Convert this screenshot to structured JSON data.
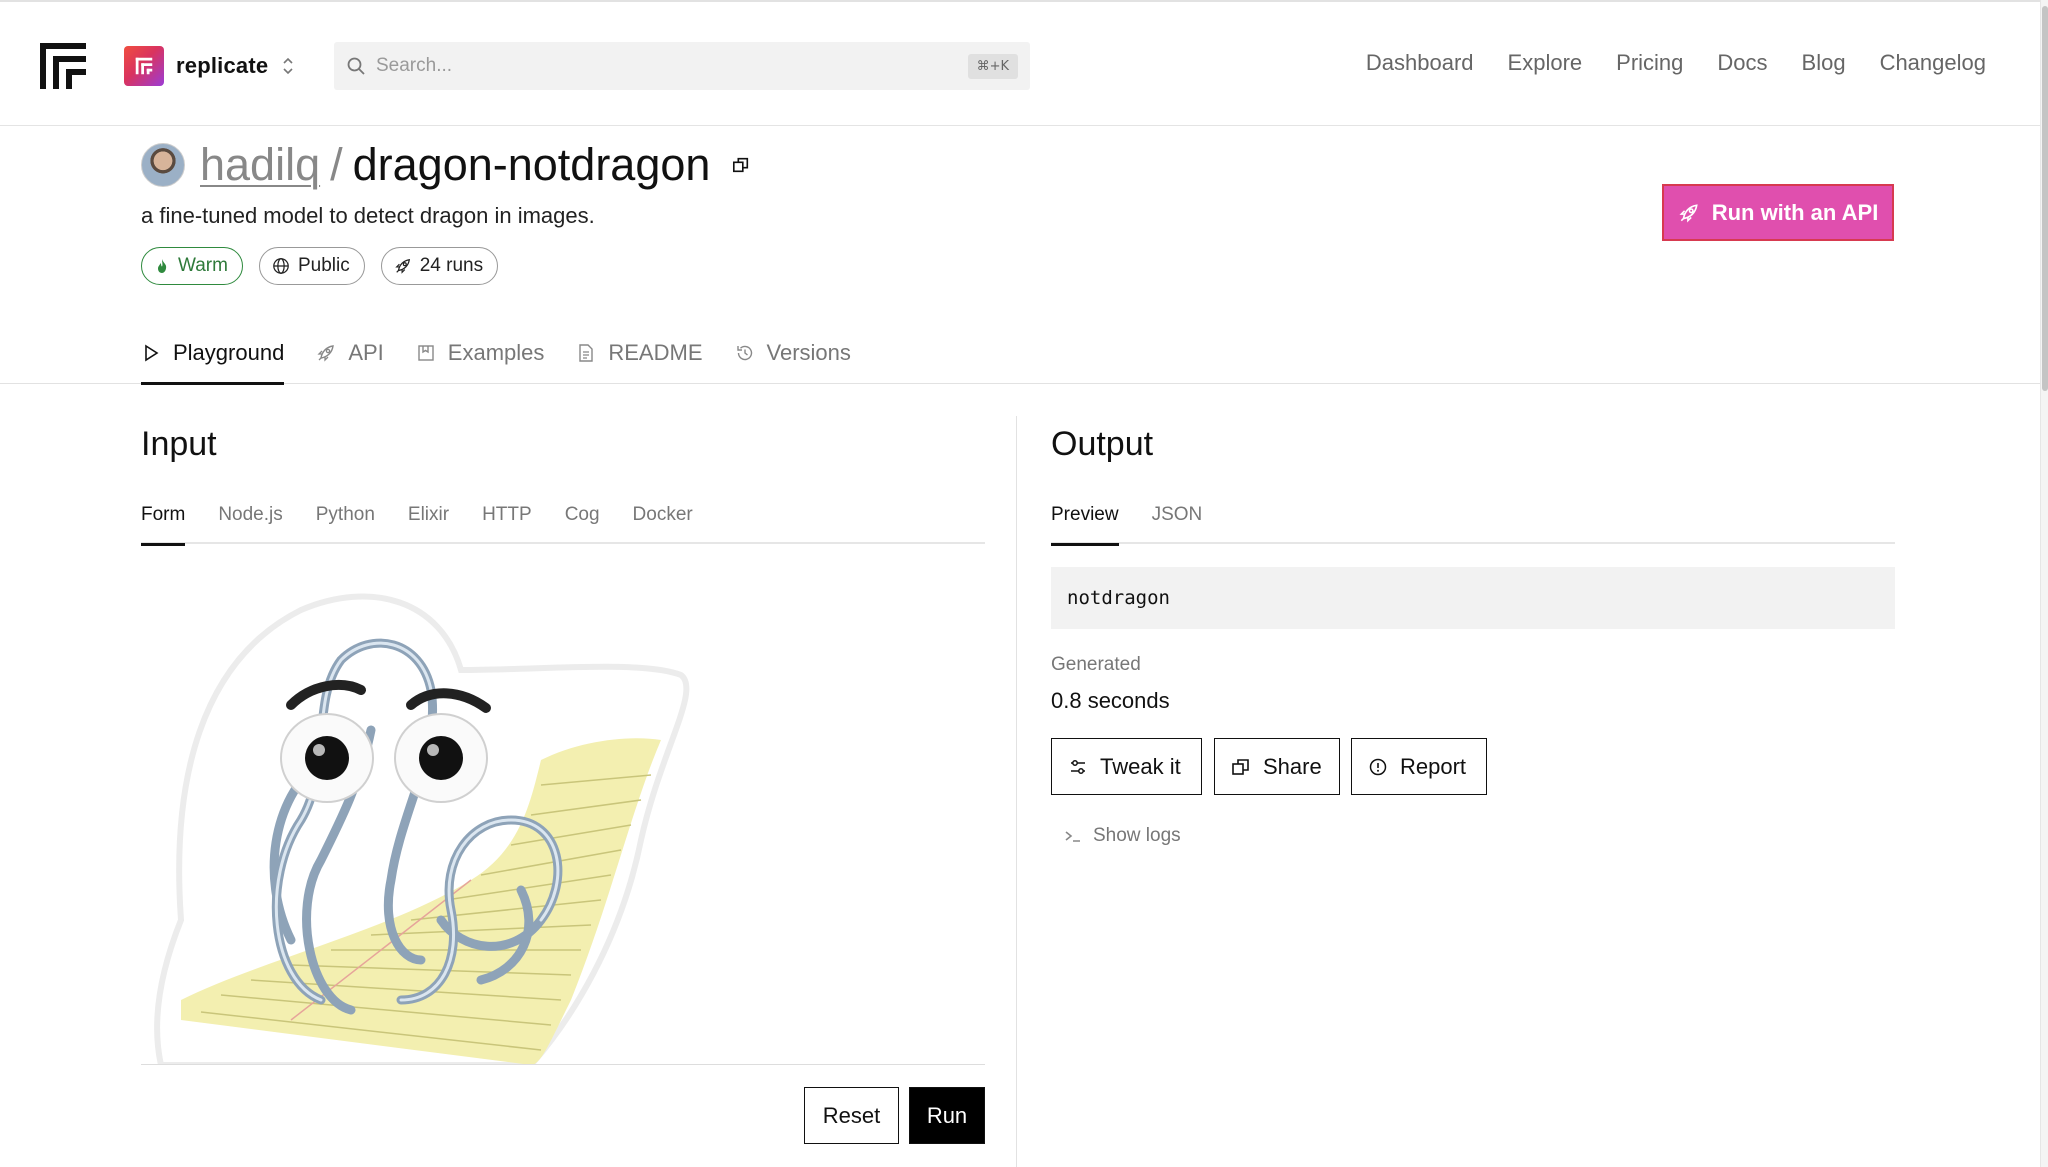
{
  "nav": {
    "org_name": "replicate",
    "search_placeholder": "Search...",
    "search_shortcut": "⌘+K",
    "links": [
      "Dashboard",
      "Explore",
      "Pricing",
      "Docs",
      "Blog",
      "Changelog"
    ]
  },
  "model": {
    "owner": "hadilq",
    "separator": "/",
    "name": "dragon-notdragon",
    "description": "a fine-tuned model to detect dragon in images.",
    "badges": {
      "warm": "Warm",
      "visibility": "Public",
      "runs": "24 runs"
    },
    "api_button": "Run with an API"
  },
  "tabs": [
    "Playground",
    "API",
    "Examples",
    "README",
    "Versions"
  ],
  "input": {
    "title": "Input",
    "subtabs": [
      "Form",
      "Node.js",
      "Python",
      "Elixir",
      "HTTP",
      "Cog",
      "Docker"
    ],
    "reset_label": "Reset",
    "run_label": "Run"
  },
  "output": {
    "title": "Output",
    "subtabs": [
      "Preview",
      "JSON"
    ],
    "result": "notdragon",
    "generated_label": "Generated",
    "generated_value": "0.8 seconds",
    "tweak_label": "Tweak it",
    "share_label": "Share",
    "report_label": "Report",
    "show_logs_label": "Show logs"
  },
  "colors": {
    "api_button_bg": "#e04fae",
    "warm_green": "#2f7a3a",
    "brand_gradient": [
      "#f04e3f",
      "#9b3cd6"
    ]
  }
}
